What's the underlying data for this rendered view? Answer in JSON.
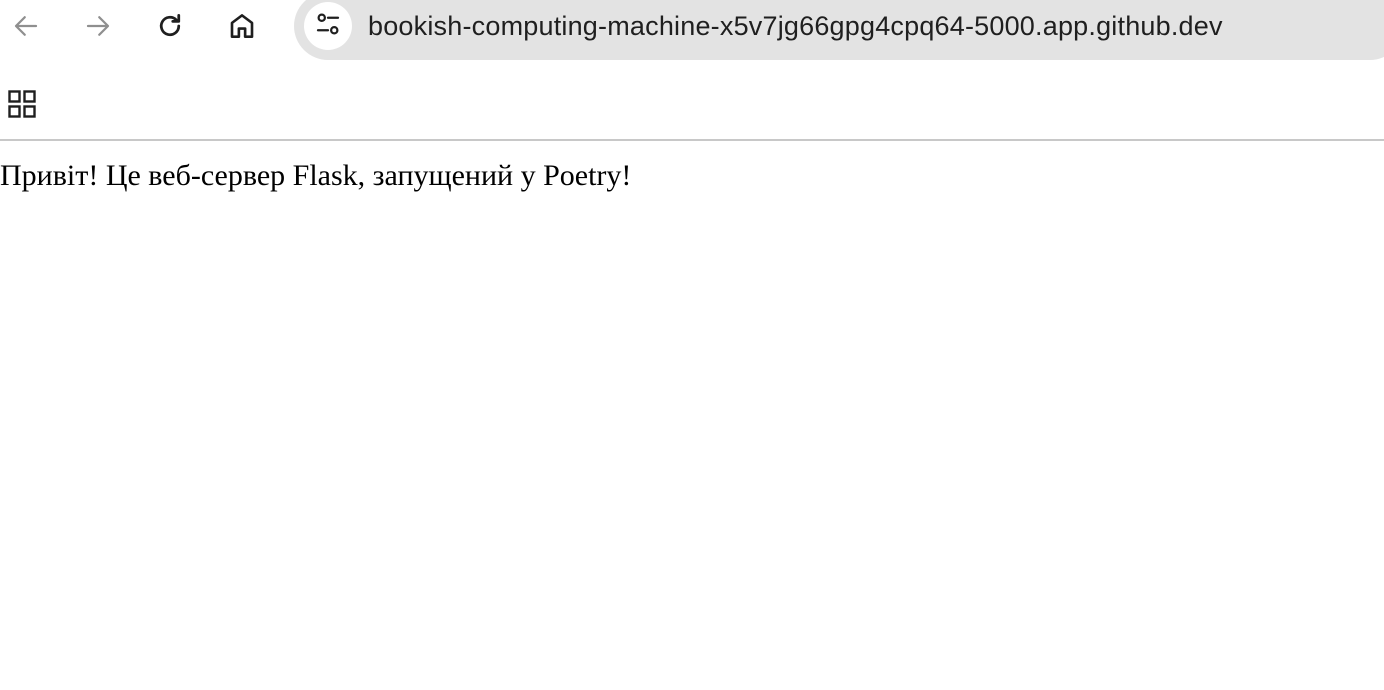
{
  "browser": {
    "url": "bookish-computing-machine-x5v7jg66gpg4cpq64-5000.app.github.dev",
    "icons": {
      "back": "arrow-left-icon",
      "forward": "arrow-right-icon",
      "reload": "reload-icon",
      "home": "home-icon",
      "site_info": "tune-icon",
      "apps": "apps-grid-icon"
    },
    "colors": {
      "omnibox_bg": "#e3e3e3",
      "disabled_icon": "#8f8f8f",
      "active_icon": "#1f1f1f"
    }
  },
  "page": {
    "text": "Привіт! Це веб-сервер Flask, запущений у Poetry!"
  }
}
